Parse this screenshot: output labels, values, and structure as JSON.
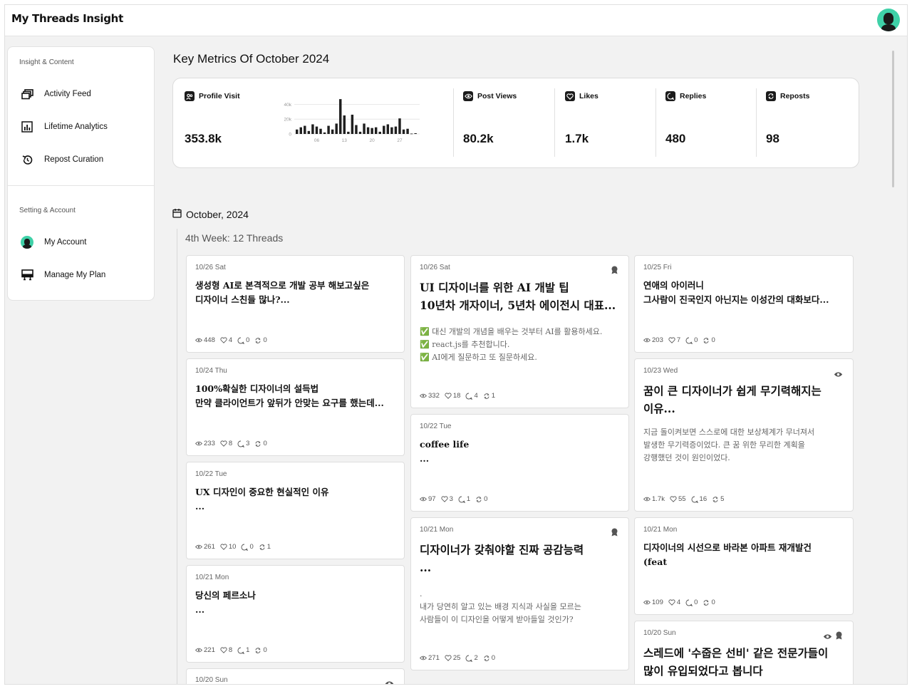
{
  "app": {
    "title": "My Threads Insight"
  },
  "sidebar": {
    "section1": "Insight & Content",
    "section2": "Setting & Account",
    "items": [
      {
        "label": "Activity Feed",
        "icon": "activity-feed-icon"
      },
      {
        "label": "Lifetime Analytics",
        "icon": "analytics-icon"
      },
      {
        "label": "Repost Curation",
        "icon": "repost-curation-icon"
      },
      {
        "label": "My Account",
        "icon": "avatar"
      },
      {
        "label": "Manage My Plan",
        "icon": "plan-icon"
      }
    ]
  },
  "metrics": {
    "title": "Key Metrics Of October 2024",
    "items": [
      {
        "label": "Profile Visit",
        "value": "353.8k",
        "icon": "profile-visit-icon"
      },
      {
        "label": "Post Views",
        "value": "80.2k",
        "icon": "eye-icon"
      },
      {
        "label": "Likes",
        "value": "1.7k",
        "icon": "heart-icon"
      },
      {
        "label": "Replies",
        "value": "480",
        "icon": "reply-icon"
      },
      {
        "label": "Reposts",
        "value": "98",
        "icon": "repost-icon"
      }
    ]
  },
  "chart_data": {
    "type": "bar",
    "title": "",
    "xlabel": "",
    "ylabel": "",
    "ylim": [
      0,
      50000
    ],
    "yticks": [
      "0",
      "20k",
      "40k"
    ],
    "xticks": [
      "06",
      "13",
      "20",
      "27"
    ],
    "categories": [
      "1",
      "2",
      "3",
      "4",
      "5",
      "6",
      "7",
      "8",
      "9",
      "10",
      "11",
      "12",
      "13",
      "14",
      "15",
      "16",
      "17",
      "18",
      "19",
      "20",
      "21",
      "22",
      "23",
      "24",
      "25",
      "26",
      "27",
      "28",
      "29",
      "30",
      "31"
    ],
    "values": [
      6000,
      9000,
      11000,
      4000,
      13000,
      10000,
      7000,
      2000,
      11000,
      6000,
      14000,
      47000,
      25000,
      3000,
      26000,
      12000,
      3000,
      14000,
      9000,
      8000,
      9000,
      3000,
      11000,
      13000,
      9000,
      10000,
      21000,
      6000,
      7000,
      500,
      1000
    ]
  },
  "calendar": {
    "month": "October, 2024",
    "week": "4th Week: 12 Threads"
  },
  "stat_icons": {
    "views": "eye-icon",
    "likes": "heart-icon",
    "replies": "reply-icon",
    "reposts": "repost-icon"
  },
  "cards": [
    {
      "date": "10/26 Sat",
      "title": "생성형 AI로 본격적으로 개발 공부 해보고싶은\n디자이너 스친들 많나?...",
      "body": "",
      "views": "448",
      "likes": "4",
      "replies": "0",
      "reposts": "0"
    },
    {
      "date": "10/24 Thu",
      "title": "100%확실한 디자이너의 설득법\n만약 클라이언트가 앞뒤가 안맞는 요구를 했는데...",
      "body": "",
      "views": "233",
      "likes": "8",
      "replies": "3",
      "reposts": "0"
    },
    {
      "date": "10/22 Tue",
      "title": "UX 디자인이 중요한 현실적인 이유\n...",
      "body": "",
      "views": "261",
      "likes": "10",
      "replies": "0",
      "reposts": "1"
    },
    {
      "date": "10/21 Mon",
      "title": "당신의 페르소나\n...",
      "body": "",
      "views": "221",
      "likes": "8",
      "replies": "1",
      "reposts": "0"
    },
    {
      "date": "10/20 Sun",
      "title": "",
      "body": "",
      "views": "",
      "likes": "",
      "replies": "",
      "reposts": ""
    },
    {
      "date": "10/26 Sat",
      "title": "UI 디자이너를 위한 AI 개발 팁\n10년차 개자이너, 5년차 에이전시 대표...",
      "body": "✅ 대신 개발의 개념을 배우는 것부터 AI를 활용하세요.\n✅ react.js를 추천합니다.\n✅ AI에게 질문하고 또 질문하세요.",
      "views": "332",
      "likes": "18",
      "replies": "4",
      "reposts": "1"
    },
    {
      "date": "10/22 Tue",
      "title": "coffee life\n...",
      "body": "",
      "views": "97",
      "likes": "3",
      "replies": "1",
      "reposts": "0"
    },
    {
      "date": "10/21 Mon",
      "title": "디자이너가 갖춰야할 진짜 공감능력\n...",
      "body": ".\n내가 당연히 알고 있는 배경 지식과 사실을 모르는\n사람들이 이 디자인을 어떻게 받아들일 것인가?",
      "views": "271",
      "likes": "25",
      "replies": "2",
      "reposts": "0"
    },
    {
      "date": "10/25 Fri",
      "title": "연애의 아이러니\n그사람이 진국인지 아닌지는 이성간의 대화보다...",
      "body": "",
      "views": "203",
      "likes": "7",
      "replies": "0",
      "reposts": "0"
    },
    {
      "date": "10/23 Wed",
      "title": "꿈이 큰 디자이너가 쉽게 무기력해지는\n이유...",
      "body": "지금 돌이켜보면 스스로에 대한 보상체계가 무너져서\n발생한 무기력증이었다. 큰 꿈 위한 무리한 계획을\n강행했던 것이 원인이었다.",
      "views": "1.7k",
      "likes": "55",
      "replies": "16",
      "reposts": "5"
    },
    {
      "date": "10/21 Mon",
      "title": "디자이너의 시선으로 바라본 아파트 재개발건\n(feat",
      "body": "",
      "views": "109",
      "likes": "4",
      "replies": "0",
      "reposts": "0"
    },
    {
      "date": "10/20 Sun",
      "title": "스레드에 '수줍은 선비' 같은 전문가들이\n많이 유입되었다고 봅니다",
      "body": "",
      "views": "",
      "likes": "",
      "replies": "",
      "reposts": ""
    }
  ]
}
